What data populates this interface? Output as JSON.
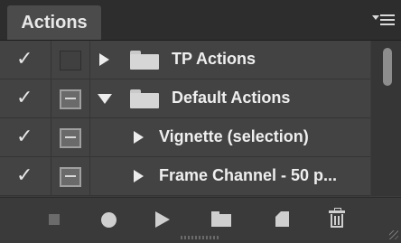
{
  "panel": {
    "tab_label": "Actions",
    "menu_icon": "panel-menu-icon"
  },
  "actions": [
    {
      "checked": true,
      "dialog": "none",
      "expander": "collapsed",
      "icon": "folder-icon",
      "label": "TP Actions"
    },
    {
      "checked": true,
      "dialog": "on",
      "expander": "expanded",
      "icon": "open-folder-icon",
      "label": "Default Actions"
    },
    {
      "checked": true,
      "dialog": "on",
      "expander": "collapsed",
      "icon": "none",
      "label": "Vignette (selection)"
    },
    {
      "checked": true,
      "dialog": "on",
      "expander": "collapsed",
      "icon": "none",
      "label": "Frame Channel - 50 p..."
    }
  ],
  "toolbar": {
    "buttons": [
      "stop-playing-icon",
      "begin-recording-icon",
      "play-selection-icon",
      "create-new-set-icon",
      "create-new-action-icon",
      "delete-icon"
    ]
  }
}
